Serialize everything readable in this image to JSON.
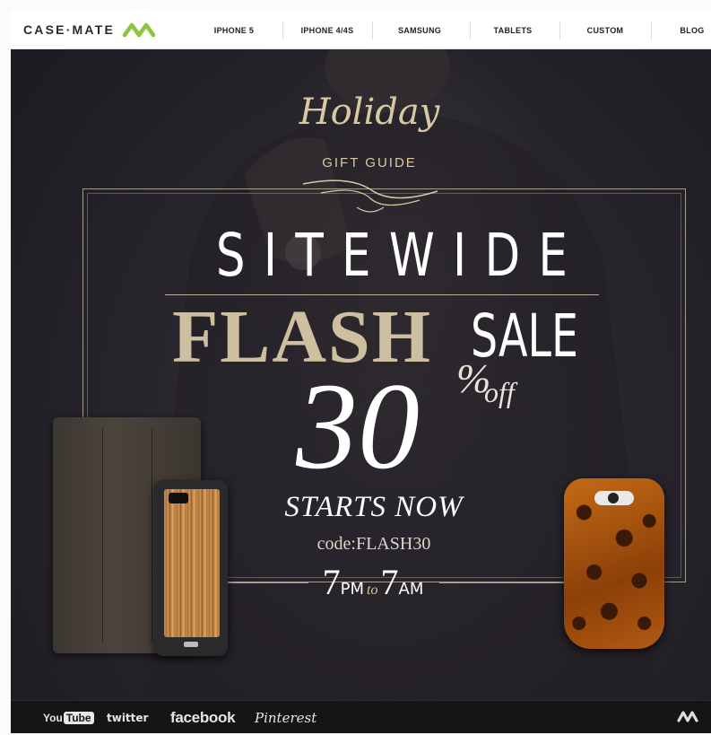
{
  "brand": {
    "name": "CASE·MATE"
  },
  "nav": {
    "items": [
      "IPHONE 5",
      "IPHONE 4/4S",
      "SAMSUNG",
      "TABLETS",
      "CUSTOM",
      "BLOG"
    ]
  },
  "hero": {
    "holiday": "Holiday",
    "gift_guide": "GIFT GUIDE",
    "sitewide": "SITEWIDE",
    "flash": "FLASH",
    "sale": "SALE",
    "discount": "30",
    "percent": "%",
    "off": "off",
    "starts": "STARTS NOW",
    "code": "code:FLASH30",
    "time": {
      "start_num": "7",
      "start_unit": "PM",
      "to": "to",
      "end_num": "7",
      "end_unit": "AM"
    }
  },
  "footer": {
    "youtube_a": "You",
    "youtube_b": "Tube",
    "twitter": "twitter",
    "facebook": "facebook",
    "pinterest": "Pinterest"
  },
  "colors": {
    "gold": "#cdbf9f",
    "bg": "#27242c",
    "logo_green": "#8cc63f"
  }
}
